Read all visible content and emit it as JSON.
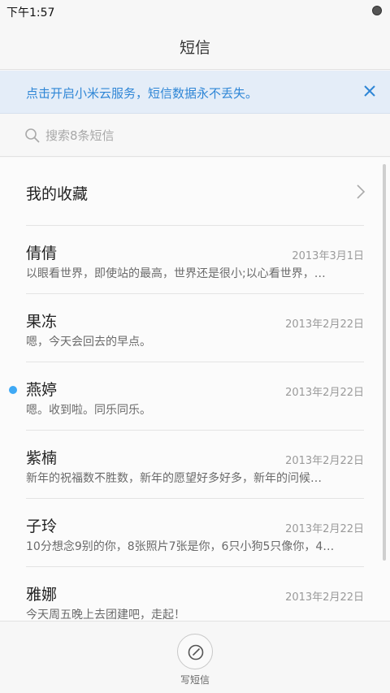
{
  "status_bar": {
    "time": "下午1:57"
  },
  "header": {
    "title": "短信"
  },
  "banner": {
    "text": "点击开启小米云服务，短信数据永不丢失。"
  },
  "search": {
    "placeholder": "搜索8条短信"
  },
  "favorites": {
    "label": "我的收藏"
  },
  "conversations": [
    {
      "name": "倩倩",
      "date": "2013年3月1日",
      "preview": "以眼看世界，即使站的最高，世界还是很小;以心看世界，…",
      "unread": false
    },
    {
      "name": "果冻",
      "date": "2013年2月22日",
      "preview": "嗯，今天会回去的早点。",
      "unread": false
    },
    {
      "name": "燕婷",
      "date": "2013年2月22日",
      "preview": "嗯。收到啦。同乐同乐。",
      "unread": true
    },
    {
      "name": "紫楠",
      "date": "2013年2月22日",
      "preview": "新年的祝福数不胜数，新年的愿望好多好多，新年的问候…",
      "unread": false
    },
    {
      "name": "子玲",
      "date": "2013年2月22日",
      "preview": "10分想念9别的你，8张照片7张是你，6只小狗5只像你，4…",
      "unread": false
    },
    {
      "name": "雅娜",
      "date": "2013年2月22日",
      "preview": "今天周五晚上去团建吧，走起！",
      "unread": false
    }
  ],
  "bottom_bar": {
    "compose_label": "写短信"
  },
  "colors": {
    "accent": "#2f86d6",
    "unread": "#3fa9f5",
    "banner_bg": "#e4edf8"
  },
  "icons": {
    "close": "close-icon",
    "search": "search-icon",
    "chevron": "chevron-right-icon",
    "compose": "compose-icon"
  }
}
